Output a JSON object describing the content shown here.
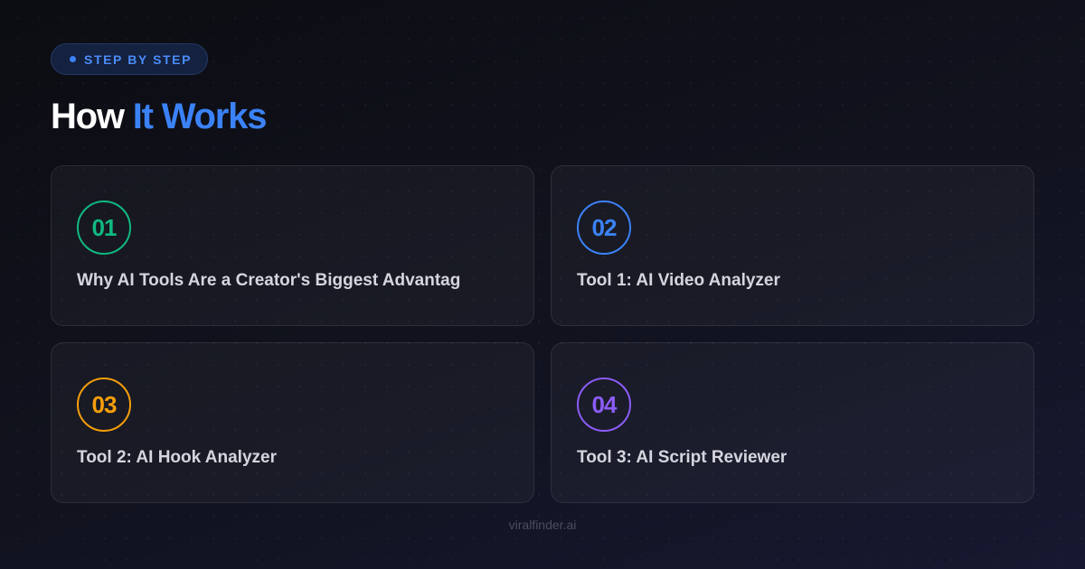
{
  "badge": {
    "label": "STEP BY STEP",
    "color": "#3b82f6"
  },
  "title": {
    "part1": "How",
    "part2": "It Works",
    "accent": "#3b82f6"
  },
  "steps": [
    {
      "number": "01",
      "title": "Why AI Tools Are a Creator's Biggest Advantag",
      "color": "#10b981"
    },
    {
      "number": "02",
      "title": "Tool 1: AI Video Analyzer",
      "color": "#3b82f6"
    },
    {
      "number": "03",
      "title": "Tool 2: AI Hook Analyzer",
      "color": "#f59e0b"
    },
    {
      "number": "04",
      "title": "Tool 3: AI Script Reviewer",
      "color": "#8b5cf6"
    }
  ],
  "footer": {
    "text": "viralfinder.ai"
  }
}
